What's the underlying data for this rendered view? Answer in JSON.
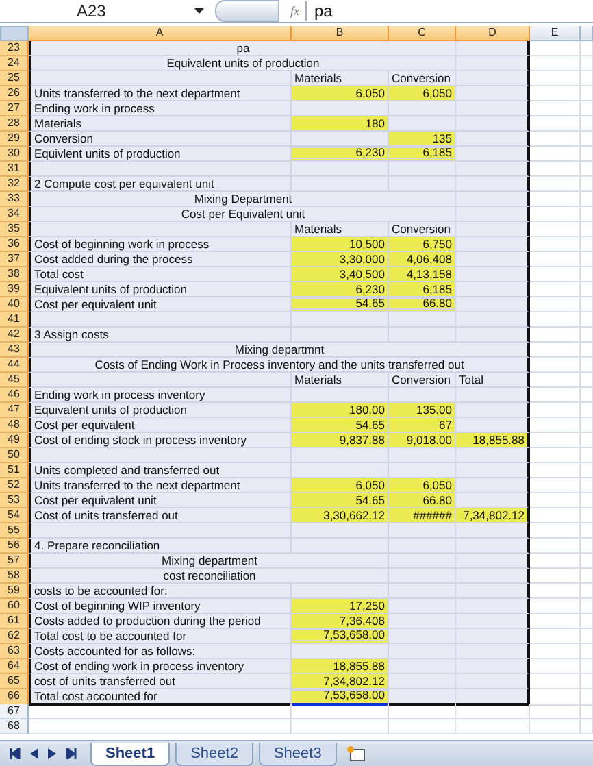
{
  "formula_bar": {
    "name_box": "A23",
    "function_button": "fx",
    "formula": "pa"
  },
  "columns": [
    {
      "label": "A",
      "selected": true
    },
    {
      "label": "B",
      "selected": true
    },
    {
      "label": "C",
      "selected": true
    },
    {
      "label": "D",
      "selected": true
    },
    {
      "label": "E",
      "selected": false
    }
  ],
  "rows": [
    {
      "number": "23",
      "selected": true,
      "abc": {
        "kind": "title",
        "text": "pa",
        "highlighted": false
      }
    },
    {
      "number": "24",
      "selected": true,
      "abc": {
        "kind": "title",
        "text": "Equivalent units of production",
        "highlighted": false
      }
    },
    {
      "number": "25",
      "selected": true,
      "b": {
        "kind": "text",
        "text": "Materials",
        "highlighted": false
      },
      "c": {
        "kind": "text",
        "text": "Conversion",
        "highlighted": false
      }
    },
    {
      "number": "26",
      "selected": true,
      "a": {
        "kind": "text",
        "text": "Units transferred to the next department",
        "highlighted": false
      },
      "b": {
        "kind": "number",
        "text": "6,050",
        "highlighted": true
      },
      "c": {
        "kind": "number",
        "text": "6,050",
        "highlighted": true
      }
    },
    {
      "number": "27",
      "selected": true,
      "a": {
        "kind": "text",
        "text": "Ending work in process",
        "highlighted": false
      }
    },
    {
      "number": "28",
      "selected": true,
      "a": {
        "kind": "text",
        "text": "Materials",
        "highlighted": false
      },
      "b": {
        "kind": "number",
        "text": "180",
        "highlighted": true
      }
    },
    {
      "number": "29",
      "selected": true,
      "a": {
        "kind": "text",
        "text": "Conversion",
        "highlighted": false
      },
      "c": {
        "kind": "number",
        "text": "135",
        "highlighted": true
      }
    },
    {
      "number": "30",
      "selected": true,
      "a": {
        "kind": "text",
        "text": "Equivlent units of production",
        "highlighted": false
      },
      "b": {
        "kind": "total",
        "text": "6,230",
        "highlighted": true
      },
      "c": {
        "kind": "total",
        "text": "6,185",
        "highlighted": true
      }
    },
    {
      "number": "31",
      "selected": true
    },
    {
      "number": "32",
      "selected": true,
      "a": {
        "kind": "text",
        "text": "2 Compute cost per equivalent unit",
        "highlighted": false
      }
    },
    {
      "number": "33",
      "selected": true,
      "abc": {
        "kind": "title",
        "text": "Mixing Department",
        "highlighted": false
      }
    },
    {
      "number": "34",
      "selected": true,
      "abc": {
        "kind": "title",
        "text": "Cost per Equivalent unit",
        "highlighted": false
      }
    },
    {
      "number": "35",
      "selected": true,
      "b": {
        "kind": "text",
        "text": "Materials",
        "highlighted": false
      },
      "c": {
        "kind": "text",
        "text": "Conversion",
        "highlighted": false
      }
    },
    {
      "number": "36",
      "selected": true,
      "a": {
        "kind": "text",
        "text": "Cost of beginning work in process",
        "highlighted": false
      },
      "b": {
        "kind": "number",
        "text": "10,500",
        "highlighted": true
      },
      "c": {
        "kind": "number",
        "text": "6,750",
        "highlighted": true
      }
    },
    {
      "number": "37",
      "selected": true,
      "a": {
        "kind": "text",
        "text": "Cost added during the process",
        "highlighted": false
      },
      "b": {
        "kind": "number",
        "text": "3,30,000",
        "highlighted": true
      },
      "c": {
        "kind": "number",
        "text": "4,06,408",
        "highlighted": true
      }
    },
    {
      "number": "38",
      "selected": true,
      "a": {
        "kind": "text",
        "text": "Total cost",
        "highlighted": false
      },
      "b": {
        "kind": "number",
        "text": "3,40,500",
        "highlighted": true
      },
      "c": {
        "kind": "number",
        "text": "4,13,158",
        "highlighted": true
      }
    },
    {
      "number": "39",
      "selected": true,
      "a": {
        "kind": "text",
        "text": "Equivalent units of production",
        "highlighted": false
      },
      "b": {
        "kind": "number",
        "text": "6,230",
        "highlighted": true
      },
      "c": {
        "kind": "number",
        "text": "6,185",
        "highlighted": true
      }
    },
    {
      "number": "40",
      "selected": true,
      "a": {
        "kind": "text",
        "text": "Cost per equivalent unit",
        "highlighted": false
      },
      "b": {
        "kind": "total",
        "text": "54.65",
        "highlighted": true
      },
      "c": {
        "kind": "total",
        "text": "66.80",
        "highlighted": true
      }
    },
    {
      "number": "41",
      "selected": true
    },
    {
      "number": "42",
      "selected": true,
      "a": {
        "kind": "text",
        "text": "3 Assign costs",
        "highlighted": false
      }
    },
    {
      "number": "43",
      "selected": true,
      "abcd": {
        "kind": "title",
        "text": "Mixing departmnt",
        "highlighted": false
      }
    },
    {
      "number": "44",
      "selected": true,
      "abcd": {
        "kind": "title",
        "text": "Costs of Ending Work in Process inventory and the units transferred out",
        "highlighted": false
      }
    },
    {
      "number": "45",
      "selected": true,
      "b": {
        "kind": "text",
        "text": "Materials",
        "highlighted": false
      },
      "c": {
        "kind": "text",
        "text": "Conversion",
        "highlighted": false
      },
      "d": {
        "kind": "text",
        "text": "Total",
        "highlighted": false
      }
    },
    {
      "number": "46",
      "selected": true,
      "a": {
        "kind": "text",
        "text": "Ending work in process inventory",
        "highlighted": false
      }
    },
    {
      "number": "47",
      "selected": true,
      "a": {
        "kind": "text",
        "text": "Equivalent units of production",
        "highlighted": false
      },
      "b": {
        "kind": "number",
        "text": "180.00",
        "highlighted": true
      },
      "c": {
        "kind": "number",
        "text": "135.00",
        "highlighted": true
      }
    },
    {
      "number": "48",
      "selected": true,
      "a": {
        "kind": "text",
        "text": "Cost per equivalent",
        "highlighted": false
      },
      "b": {
        "kind": "number",
        "text": "54.65",
        "highlighted": true
      },
      "c": {
        "kind": "number",
        "text": "67",
        "highlighted": true
      }
    },
    {
      "number": "49",
      "selected": true,
      "a": {
        "kind": "text",
        "text": "Cost of ending stock in process inventory",
        "highlighted": false
      },
      "b": {
        "kind": "number",
        "text": "9,837.88",
        "highlighted": true
      },
      "c": {
        "kind": "number",
        "text": "9,018.00",
        "highlighted": true
      },
      "d": {
        "kind": "number",
        "text": "18,855.88",
        "highlighted": true
      }
    },
    {
      "number": "50",
      "selected": true
    },
    {
      "number": "51",
      "selected": true,
      "a": {
        "kind": "text",
        "text": "Units completed and transferred out",
        "highlighted": false
      }
    },
    {
      "number": "52",
      "selected": true,
      "a": {
        "kind": "text",
        "text": "Units transferred to the next department",
        "highlighted": false
      },
      "b": {
        "kind": "number",
        "text": "6,050",
        "highlighted": true
      },
      "c": {
        "kind": "number",
        "text": "6,050",
        "highlighted": true
      }
    },
    {
      "number": "53",
      "selected": true,
      "a": {
        "kind": "text",
        "text": "Cost per equivalent unit",
        "highlighted": false
      },
      "b": {
        "kind": "number",
        "text": "54.65",
        "highlighted": true
      },
      "c": {
        "kind": "number",
        "text": "66.80",
        "highlighted": true
      }
    },
    {
      "number": "54",
      "selected": true,
      "a": {
        "kind": "text",
        "text": "Cost of units transferred out",
        "highlighted": false
      },
      "b": {
        "kind": "number",
        "text": "3,30,662.12",
        "highlighted": true
      },
      "c": {
        "kind": "number",
        "text": "######",
        "highlighted": true
      },
      "d": {
        "kind": "number",
        "text": "7,34,802.12",
        "highlighted": true
      }
    },
    {
      "number": "55",
      "selected": true
    },
    {
      "number": "56",
      "selected": true,
      "a": {
        "kind": "text",
        "text": "4. Prepare reconciliation",
        "highlighted": false
      }
    },
    {
      "number": "57",
      "selected": true,
      "ab": {
        "kind": "title",
        "text": "Mixing department",
        "highlighted": false
      }
    },
    {
      "number": "58",
      "selected": true,
      "ab": {
        "kind": "title",
        "text": "cost reconciliation",
        "highlighted": false
      }
    },
    {
      "number": "59",
      "selected": true,
      "a": {
        "kind": "text",
        "text": "costs to be accounted for:",
        "highlighted": false
      }
    },
    {
      "number": "60",
      "selected": true,
      "a": {
        "kind": "text",
        "text": "Cost of beginning WIP inventory",
        "highlighted": false
      },
      "b": {
        "kind": "number",
        "text": "17,250",
        "highlighted": true
      }
    },
    {
      "number": "61",
      "selected": true,
      "a": {
        "kind": "text",
        "text": "Costs added to production during the period",
        "highlighted": false
      },
      "b": {
        "kind": "number",
        "text": "7,36,408",
        "highlighted": true
      }
    },
    {
      "number": "62",
      "selected": true,
      "a": {
        "kind": "text",
        "text": "Total cost to be accounted for",
        "highlighted": false
      },
      "b": {
        "kind": "total",
        "text": "7,53,658.00",
        "highlighted": true
      }
    },
    {
      "number": "63",
      "selected": true,
      "a": {
        "kind": "text",
        "text": "Costs accounted for as follows:",
        "highlighted": false
      }
    },
    {
      "number": "64",
      "selected": true,
      "a": {
        "kind": "text",
        "text": "Cost of ending work in process inventory",
        "highlighted": false
      },
      "b": {
        "kind": "number",
        "text": "18,855.88",
        "highlighted": true
      }
    },
    {
      "number": "65",
      "selected": true,
      "a": {
        "kind": "text",
        "text": "cost of units transferred out",
        "highlighted": false
      },
      "b": {
        "kind": "number",
        "text": "7,34,802.12",
        "highlighted": true
      }
    },
    {
      "number": "66",
      "selected": true,
      "a": {
        "kind": "text",
        "text": "Total cost accounted for",
        "highlighted": false
      },
      "b": {
        "kind": "total",
        "text": "7,53,658.00",
        "highlighted": true
      }
    },
    {
      "number": "67",
      "selected": false
    },
    {
      "number": "68",
      "selected": false
    }
  ],
  "sheet_tabs": [
    {
      "label": "Sheet1",
      "selected": true
    },
    {
      "label": "Sheet2",
      "selected": false
    },
    {
      "label": "Sheet3",
      "selected": false
    }
  ]
}
